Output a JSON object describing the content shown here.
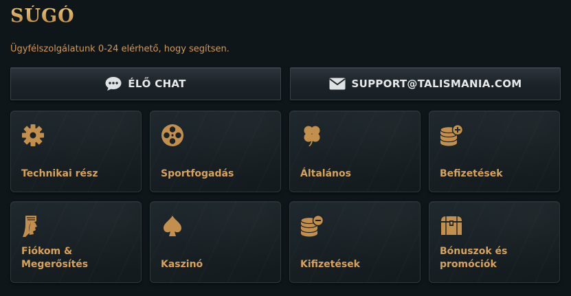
{
  "header": {
    "title": "SÚGÓ",
    "subtitle": "Ügyfélszolgálatunk 0-24 elérhető, hogy segítsen."
  },
  "contact": {
    "chat_label": "ÉLŐ CHAT",
    "chat_icon": "chat-bubble-icon",
    "email_label": "SUPPORT@TALISMANIA.COM",
    "email_icon": "envelope-icon"
  },
  "categories": [
    {
      "label": "Technikai rész",
      "icon": "gear-icon"
    },
    {
      "label": "Sportfogadás",
      "icon": "film-reel-icon"
    },
    {
      "label": "Általános",
      "icon": "clover-icon"
    },
    {
      "label": "Befizetések",
      "icon": "coins-plus-icon"
    },
    {
      "label": "Fiókom & Megerősítés",
      "icon": "pharaoh-icon"
    },
    {
      "label": "Kaszinó",
      "icon": "spade-icon"
    },
    {
      "label": "Kifizetések",
      "icon": "coins-minus-icon"
    },
    {
      "label": "Bónuszok és promóciók",
      "icon": "treasure-chest-icon"
    }
  ],
  "colors": {
    "background": "#0f161a",
    "accent_gold": "#d9a35a",
    "button_text": "#e7e9ea"
  }
}
